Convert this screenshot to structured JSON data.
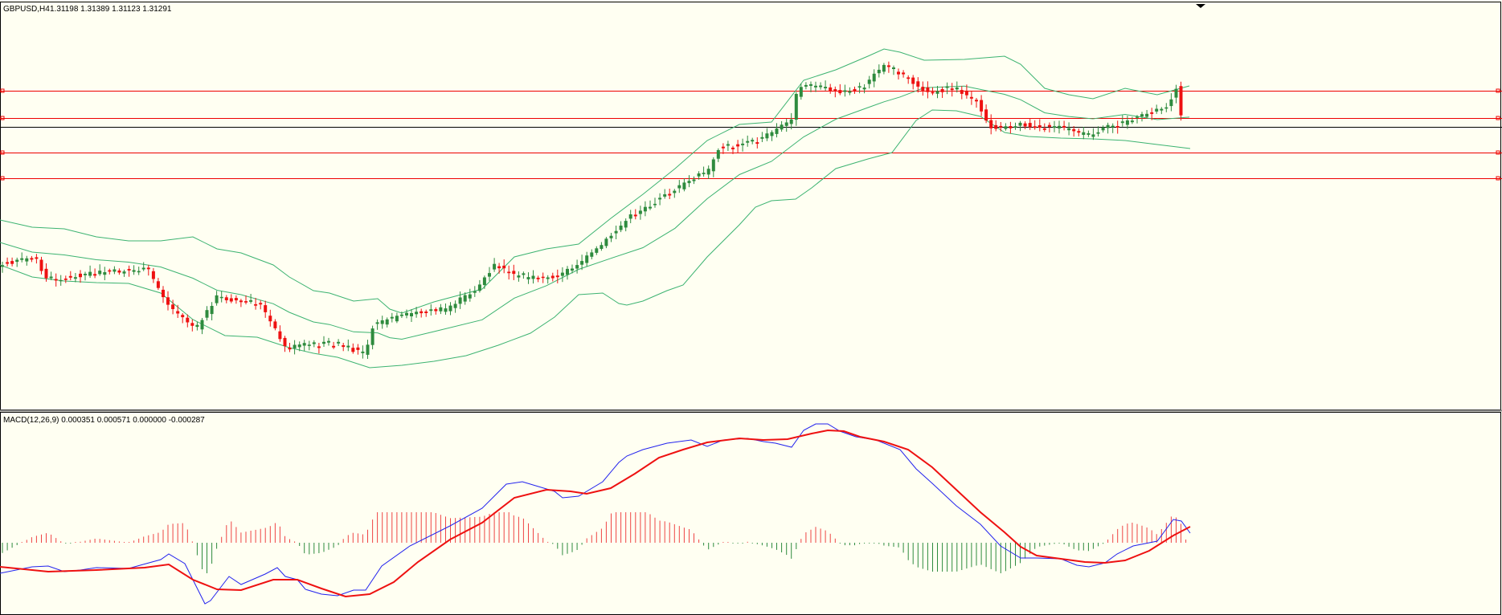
{
  "main_header": {
    "symbol": "GBPUSD,H4",
    "ohlc": "1.31198 1.31389 1.31123 1.31291"
  },
  "macd_header": {
    "label": "MACD(12,26,9) 0.000351 0.000571 0.000000 -0.000287"
  },
  "colors": {
    "background": "#fffff2",
    "bull_candle": "#2e8b3e",
    "bear_candle": "#ee1111",
    "bollinger": "#3cb371",
    "hline_red": "#ee0000",
    "hline_current": "#000000",
    "macd_line": "#2222ee",
    "signal_line": "#ee1111",
    "hist_pos": "#ee4444",
    "hist_neg": "#2e8b3e"
  },
  "chart_data": [
    {
      "type": "candlestick",
      "name": "price",
      "symbol": "GBPUSD",
      "timeframe": "H4",
      "last_bar_ohlc": [
        1.31198,
        1.31389,
        1.31123,
        1.31291
      ],
      "bars_visible": 155,
      "indicator": "bollinger_bands",
      "horizontal_levels_color": "red",
      "horizontal_levels_count": 4,
      "grid": false
    },
    {
      "type": "line",
      "name": "macd",
      "params": [
        12,
        26,
        9
      ],
      "values_shown": [
        0.000351,
        0.000571,
        0.0,
        -0.000287
      ],
      "series": [
        "macd",
        "signal",
        "histogram"
      ],
      "grid": false
    }
  ]
}
